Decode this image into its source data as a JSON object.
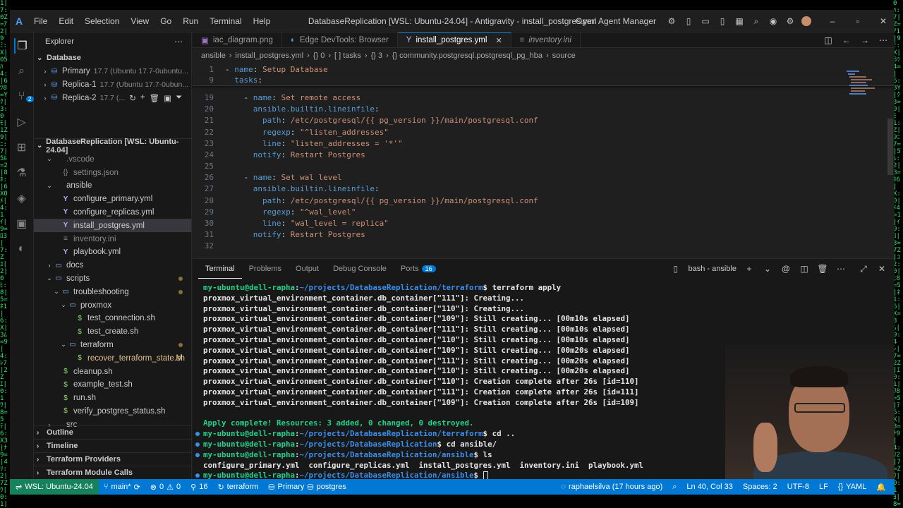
{
  "window": {
    "title": "DatabaseReplication [WSL: Ubuntu-24.04] - Antigravity - install_postgres.yml",
    "menu": [
      "File",
      "Edit",
      "Selection",
      "View",
      "Go",
      "Run",
      "Terminal",
      "Help"
    ],
    "agent_manager": "Open Agent Manager"
  },
  "activity": {
    "source_control_badge": "2"
  },
  "sidebar": {
    "header": "Explorer",
    "database_section": "Database",
    "databases": [
      {
        "name": "Primary",
        "detail": "17.7 (Ubuntu 17.7-0ubuntu..."
      },
      {
        "name": "Replica-1",
        "detail": "17.7 (Ubuntu 17.7-0ubun..."
      },
      {
        "name": "Replica-2",
        "detail": "17.7 (..."
      }
    ],
    "workspace_title": "DatabaseReplication [WSL: Ubuntu-24.04]",
    "tree": [
      {
        "label": ".vscode",
        "indent": 1,
        "kind": "folder-open",
        "faded": true
      },
      {
        "label": "settings.json",
        "indent": 2,
        "kind": "json",
        "faded": true
      },
      {
        "label": "ansible",
        "indent": 1,
        "kind": "folder-open"
      },
      {
        "label": "configure_primary.yml",
        "indent": 2,
        "kind": "yaml"
      },
      {
        "label": "configure_replicas.yml",
        "indent": 2,
        "kind": "yaml"
      },
      {
        "label": "install_postgres.yml",
        "indent": 2,
        "kind": "yaml",
        "selected": true
      },
      {
        "label": "inventory.ini",
        "indent": 2,
        "kind": "ini",
        "faded": true
      },
      {
        "label": "playbook.yml",
        "indent": 2,
        "kind": "yaml"
      },
      {
        "label": "docs",
        "indent": 1,
        "kind": "folder"
      },
      {
        "label": "scripts",
        "indent": 1,
        "kind": "folder-open",
        "modified": true
      },
      {
        "label": "troubleshooting",
        "indent": 2,
        "kind": "folder-open",
        "modified": true
      },
      {
        "label": "proxmox",
        "indent": 3,
        "kind": "folder-open"
      },
      {
        "label": "test_connection.sh",
        "indent": 4,
        "kind": "sh"
      },
      {
        "label": "test_create.sh",
        "indent": 4,
        "kind": "sh"
      },
      {
        "label": "terraform",
        "indent": 3,
        "kind": "folder-open",
        "modified": true
      },
      {
        "label": "recover_terraform_state.sh",
        "indent": 4,
        "kind": "sh",
        "git": "M"
      },
      {
        "label": "cleanup.sh",
        "indent": 2,
        "kind": "sh"
      },
      {
        "label": "example_test.sh",
        "indent": 2,
        "kind": "sh"
      },
      {
        "label": "run.sh",
        "indent": 2,
        "kind": "sh"
      },
      {
        "label": "verify_postgres_status.sh",
        "indent": 2,
        "kind": "sh"
      },
      {
        "label": "src",
        "indent": 1,
        "kind": "folder"
      }
    ],
    "bottom_sections": [
      "Outline",
      "Timeline",
      "Terraform Providers",
      "Terraform Module Calls"
    ]
  },
  "editor": {
    "tabs": [
      {
        "label": "iac_diagram.png",
        "icon": "image-icon"
      },
      {
        "label": "Edge DevTools: Browser",
        "icon": "edge-icon"
      },
      {
        "label": "install_postgres.yml",
        "icon": "yaml-icon",
        "active": true
      },
      {
        "label": "inventory.ini",
        "icon": "ini-icon",
        "italic": true
      }
    ],
    "breadcrumb": [
      "ansible",
      "install_postgres.yml",
      "{} 0",
      "[ ] tasks",
      "{} 3",
      "{} community.postgresql.postgresql_pg_hba",
      "source"
    ],
    "lines": [
      {
        "n": "1",
        "html": "<span class=\"p\">- </span><span class=\"k\">name</span><span class=\"p\">: </span><span class=\"s\">Setup Database</span>"
      },
      {
        "n": "9",
        "html": "<span class=\"p\">  </span><span class=\"k\">tasks</span><span class=\"p\">:</span>"
      },
      {
        "n": "18",
        "html": ""
      },
      {
        "n": "19",
        "html": "<span class=\"p\">    - </span><span class=\"k\">name</span><span class=\"p\">: </span><span class=\"s\">Set remote access</span>"
      },
      {
        "n": "20",
        "html": "<span class=\"p\">      </span><span class=\"k\">ansible.builtin.lineinfile</span><span class=\"p\">:</span>"
      },
      {
        "n": "21",
        "html": "<span class=\"p\">        </span><span class=\"k\">path</span><span class=\"p\">: </span><span class=\"s\">/etc/postgresql/{{ pg_version }}/main/postgresql.conf</span>"
      },
      {
        "n": "22",
        "html": "<span class=\"p\">        </span><span class=\"k\">regexp</span><span class=\"p\">: </span><span class=\"s\">\"^listen_addresses\"</span>"
      },
      {
        "n": "23",
        "html": "<span class=\"p\">        </span><span class=\"k\">line</span><span class=\"p\">: </span><span class=\"s\">\"listen_addresses = '*'\"</span>"
      },
      {
        "n": "24",
        "html": "<span class=\"p\">      </span><span class=\"k\">notify</span><span class=\"p\">: </span><span class=\"s\">Restart Postgres</span>"
      },
      {
        "n": "25",
        "html": ""
      },
      {
        "n": "26",
        "html": "<span class=\"p\">    - </span><span class=\"k\">name</span><span class=\"p\">: </span><span class=\"s\">Set wal level</span>"
      },
      {
        "n": "27",
        "html": "<span class=\"p\">      </span><span class=\"k\">ansible.builtin.lineinfile</span><span class=\"p\">:</span>"
      },
      {
        "n": "28",
        "html": "<span class=\"p\">        </span><span class=\"k\">path</span><span class=\"p\">: </span><span class=\"s\">/etc/postgresql/{{ pg_version }}/main/postgresql.conf</span>"
      },
      {
        "n": "29",
        "html": "<span class=\"p\">        </span><span class=\"k\">regexp</span><span class=\"p\">: </span><span class=\"s\">\"^wal_level\"</span>"
      },
      {
        "n": "30",
        "html": "<span class=\"p\">        </span><span class=\"k\">line</span><span class=\"p\">: </span><span class=\"s\">\"wal_level = replica\"</span>"
      },
      {
        "n": "31",
        "html": "<span class=\"p\">      </span><span class=\"k\">notify</span><span class=\"p\">: </span><span class=\"s\">Restart Postgres</span>"
      },
      {
        "n": "32",
        "html": ""
      }
    ]
  },
  "panel": {
    "tabs": [
      "Terminal",
      "Problems",
      "Output",
      "Debug Console",
      "Ports"
    ],
    "ports_badge": "16",
    "shell_label": "bash - ansible",
    "prompt_user": "my-ubuntu@dell-rapha",
    "lines": [
      {
        "type": "prompt",
        "path": "~/projects/DatabaseReplication/terraform",
        "cmd": "terraform apply",
        "mark": false
      },
      {
        "type": "out",
        "text": "proxmox_virtual_environment_container.db_container[\"111\"]: Creating..."
      },
      {
        "type": "out",
        "text": "proxmox_virtual_environment_container.db_container[\"110\"]: Creating..."
      },
      {
        "type": "out",
        "text": "proxmox_virtual_environment_container.db_container[\"109\"]: Still creating... [00m10s elapsed]"
      },
      {
        "type": "out",
        "text": "proxmox_virtual_environment_container.db_container[\"111\"]: Still creating... [00m10s elapsed]"
      },
      {
        "type": "out",
        "text": "proxmox_virtual_environment_container.db_container[\"110\"]: Still creating... [00m10s elapsed]"
      },
      {
        "type": "out",
        "text": "proxmox_virtual_environment_container.db_container[\"109\"]: Still creating... [00m20s elapsed]"
      },
      {
        "type": "out",
        "text": "proxmox_virtual_environment_container.db_container[\"111\"]: Still creating... [00m20s elapsed]"
      },
      {
        "type": "out",
        "text": "proxmox_virtual_environment_container.db_container[\"110\"]: Still creating... [00m20s elapsed]"
      },
      {
        "type": "out",
        "text": "proxmox_virtual_environment_container.db_container[\"110\"]: Creation complete after 26s [id=110]"
      },
      {
        "type": "out",
        "text": "proxmox_virtual_environment_container.db_container[\"111\"]: Creation complete after 26s [id=111]"
      },
      {
        "type": "out",
        "text": "proxmox_virtual_environment_container.db_container[\"109\"]: Creation complete after 26s [id=109]"
      },
      {
        "type": "blank",
        "text": ""
      },
      {
        "type": "ok",
        "text": "Apply complete! Resources: 3 added, 0 changed, 0 destroyed."
      },
      {
        "type": "prompt",
        "path": "~/projects/DatabaseReplication/terraform",
        "cmd": "cd ..",
        "mark": true
      },
      {
        "type": "prompt",
        "path": "~/projects/DatabaseReplication",
        "cmd": "cd ansible/",
        "mark": true
      },
      {
        "type": "prompt",
        "path": "~/projects/DatabaseReplication/ansible",
        "cmd": "ls",
        "mark": true
      },
      {
        "type": "out",
        "text": "configure_primary.yml  configure_replicas.yml  install_postgres.yml  inventory.ini  playbook.yml"
      },
      {
        "type": "prompt",
        "path": "~/projects/DatabaseReplication/ansible",
        "cmd": "",
        "mark": true,
        "cursor": true
      }
    ]
  },
  "status": {
    "remote": "WSL: Ubuntu-24.04",
    "branch": "main*",
    "errors": "0",
    "warnings": "0",
    "ports": "16",
    "terraform": "terraform",
    "db": "Primary",
    "db_name": "postgres",
    "blame": "raphaelsilva (17 hours ago)",
    "position": "Ln 40, Col 33",
    "spaces": "Spaces: 2",
    "encoding": "UTF-8",
    "eol": "LF",
    "language": "YAML"
  }
}
